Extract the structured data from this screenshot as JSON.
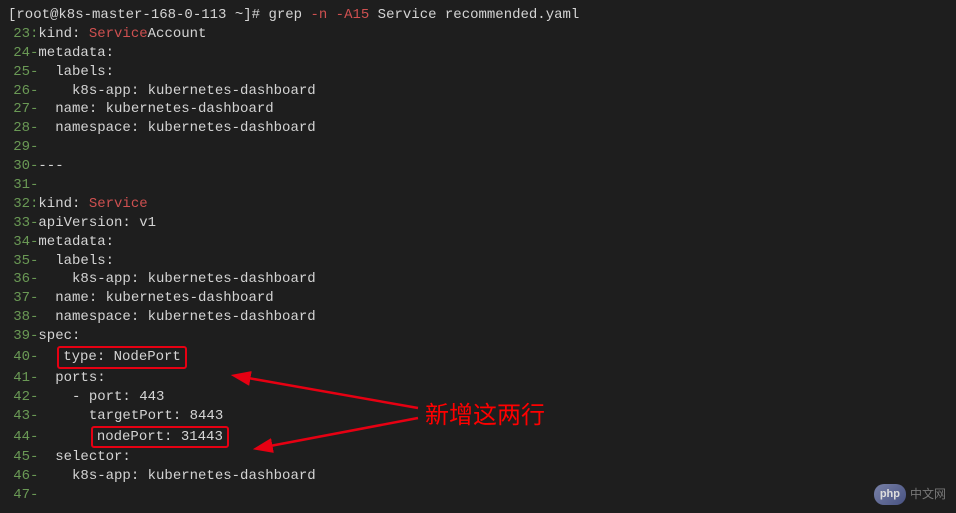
{
  "prompt": {
    "prefix": "[root@k8s-master-168-0-113 ~]# ",
    "cmd": "grep ",
    "flag": "-n -A15",
    "args": " Service recommended.yaml"
  },
  "lines": [
    {
      "n": "23",
      "sep": ":",
      "pre": "kind: ",
      "hl": "Service",
      "post": "Account"
    },
    {
      "n": "24",
      "sep": "-",
      "pre": "metadata:"
    },
    {
      "n": "25",
      "sep": "-",
      "pre": "  labels:"
    },
    {
      "n": "26",
      "sep": "-",
      "pre": "    k8s-app: kubernetes-dashboard"
    },
    {
      "n": "27",
      "sep": "-",
      "pre": "  name: kubernetes-dashboard"
    },
    {
      "n": "28",
      "sep": "-",
      "pre": "  namespace: kubernetes-dashboard"
    },
    {
      "n": "29",
      "sep": "-",
      "pre": ""
    },
    {
      "n": "30",
      "sep": "-",
      "pre": "---"
    },
    {
      "n": "31",
      "sep": "-",
      "pre": ""
    },
    {
      "n": "32",
      "sep": ":",
      "pre": "kind: ",
      "hl": "Service",
      "post": ""
    },
    {
      "n": "33",
      "sep": "-",
      "pre": "apiVersion: v1"
    },
    {
      "n": "34",
      "sep": "-",
      "pre": "metadata:"
    },
    {
      "n": "35",
      "sep": "-",
      "pre": "  labels:"
    },
    {
      "n": "36",
      "sep": "-",
      "pre": "    k8s-app: kubernetes-dashboard"
    },
    {
      "n": "37",
      "sep": "-",
      "pre": "  name: kubernetes-dashboard"
    },
    {
      "n": "38",
      "sep": "-",
      "pre": "  namespace: kubernetes-dashboard"
    },
    {
      "n": "39",
      "sep": "-",
      "pre": "spec:"
    },
    {
      "n": "40",
      "sep": "-",
      "preBlank": "  ",
      "boxed": "type: NodePort"
    },
    {
      "n": "41",
      "sep": "-",
      "pre": "  ports:"
    },
    {
      "n": "42",
      "sep": "-",
      "pre": "    - port: 443"
    },
    {
      "n": "43",
      "sep": "-",
      "pre": "      targetPort: 8443"
    },
    {
      "n": "44",
      "sep": "-",
      "preBlank": "      ",
      "boxed": "nodePort: 31443"
    },
    {
      "n": "45",
      "sep": "-",
      "pre": "  selector:"
    },
    {
      "n": "46",
      "sep": "-",
      "pre": "    k8s-app: kubernetes-dashboard"
    },
    {
      "n": "47",
      "sep": "-",
      "pre": ""
    }
  ],
  "annotation": "新增这两行",
  "watermark": {
    "logo": "php",
    "text": "中文网"
  }
}
